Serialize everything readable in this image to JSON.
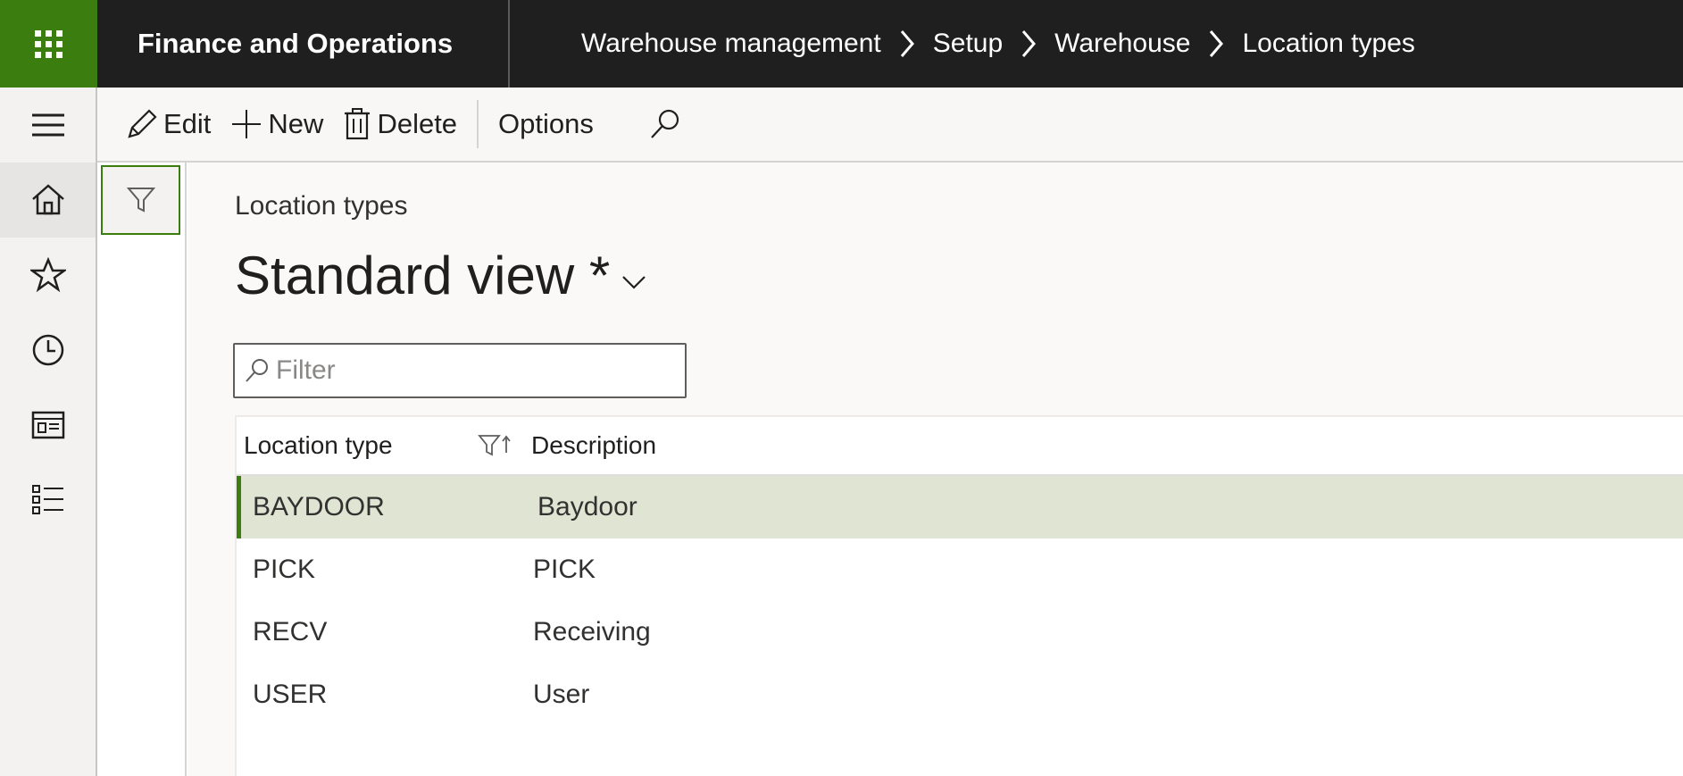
{
  "app": {
    "title": "Finance and Operations"
  },
  "breadcrumb": [
    "Warehouse management",
    "Setup",
    "Warehouse",
    "Location types"
  ],
  "toolbar": {
    "edit_label": "Edit",
    "new_label": "New",
    "delete_label": "Delete",
    "options_label": "Options"
  },
  "nav": {
    "icons": [
      "home-icon",
      "star-icon",
      "clock-icon",
      "workspace-icon",
      "list-icon"
    ]
  },
  "page": {
    "caption": "Location types",
    "view_name": "Standard view *"
  },
  "filter": {
    "placeholder": "Filter",
    "value": ""
  },
  "grid": {
    "columns": [
      "Location type",
      "Description"
    ],
    "rows": [
      {
        "location_type": "BAYDOOR",
        "description": "Baydoor",
        "selected": true
      },
      {
        "location_type": "PICK",
        "description": "PICK",
        "selected": false
      },
      {
        "location_type": "RECV",
        "description": "Receiving",
        "selected": false
      },
      {
        "location_type": "USER",
        "description": "User",
        "selected": false
      }
    ]
  },
  "colors": {
    "accent": "#3b7d0f",
    "topbar": "#1f1f1f",
    "selected_row": "#dfe4d3"
  }
}
